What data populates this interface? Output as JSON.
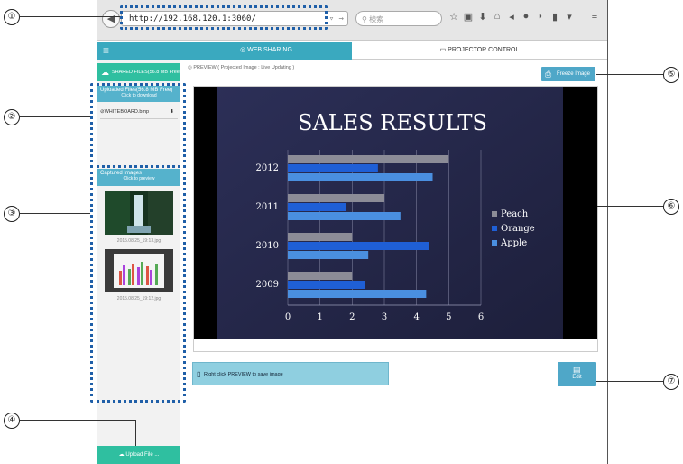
{
  "browser": {
    "url": "http://192.168.120.1:3060/",
    "search_placeholder": "検索"
  },
  "header": {
    "tab_web": "WEB SHARING",
    "tab_projector": "PROJECTOR CONTROL"
  },
  "sidebar": {
    "shared_files": "SHARED FILES",
    "shared_files_size": "(56.8 MB Free)",
    "uploaded_title": "Uploaded Files",
    "uploaded_size": "(56.8 MB Free)",
    "uploaded_sub": "Click to download",
    "file_name": "WHITEBOARD.bmp",
    "captured_title": "Captured Images",
    "captured_sub": "Click to preview",
    "image1_caption": "2015.08.25_19:13.jpg",
    "image2_caption": "2015.08.25_19:12.jpg",
    "upload_label": "Upload File ..."
  },
  "main": {
    "preview_label": "PREVIEW ( Projected Image : Live Updating )",
    "freeze_label": "Freeze Image",
    "save_hint": "Right click PREVIEW to save image",
    "edit_label": "Edit"
  },
  "callouts": [
    "①",
    "②",
    "③",
    "④",
    "⑤",
    "⑥",
    "⑦"
  ],
  "colors": {
    "accent_teal": "#3aa9bf",
    "accent_green": "#2fbfa0",
    "button_blue": "#4fa7c8",
    "peach": "#8c8c97",
    "orange": "#1f5fd6",
    "apple": "#4a8fe0"
  },
  "chart_data": {
    "type": "bar",
    "title": "SALES RESULTS",
    "categories": [
      "2009",
      "2010",
      "2011",
      "2012"
    ],
    "series": [
      {
        "name": "Peach",
        "values": [
          2,
          2,
          3,
          5
        ]
      },
      {
        "name": "Orange",
        "values": [
          2.4,
          4.4,
          1.8,
          2.8
        ]
      },
      {
        "name": "Apple",
        "values": [
          4.3,
          2.5,
          3.5,
          4.5
        ]
      }
    ],
    "xlim": [
      0,
      6
    ],
    "x_ticks": [
      "0",
      "1",
      "2",
      "3",
      "4",
      "5",
      "6"
    ]
  }
}
